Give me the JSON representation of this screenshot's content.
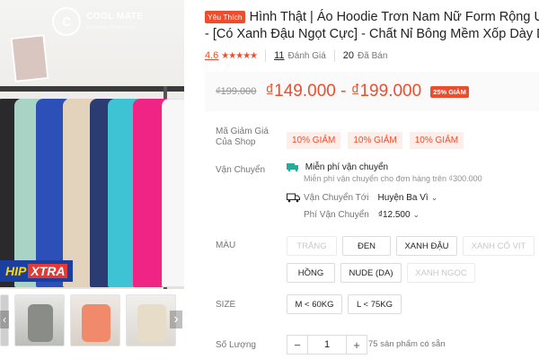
{
  "brand": {
    "logo_mark": "C",
    "name_line1": "COOL",
    "name_line2": "MATE",
    "tagline": "Everyday Outerwear"
  },
  "promo_badge": {
    "text_a": "HIP",
    "text_b": "XTRA"
  },
  "product": {
    "favorite_badge": "Yêu Thích",
    "title_line1": "Hình Thật | Áo Hoodie Trơn Nam Nữ Form Rộng Un",
    "title_line2": "- [Có Xanh Đậu Ngọt Cực] - Chất Nỉ Bông Mềm Xốp Dày Dạ",
    "rating": "4.6",
    "stars": "★★★★★",
    "review_count": "11",
    "review_label": "Đánh Giá",
    "sold_count": "20",
    "sold_label": "Đã Bán"
  },
  "price": {
    "original": "₫199.000",
    "current": "₫149.000 - ₫199.000",
    "discount": "25% GIẢM"
  },
  "vouchers": {
    "label_line1": "Mã Giảm Giá",
    "label_line2": "Của Shop",
    "items": [
      "10% GIẢM",
      "10% GIẢM",
      "10% GIẢM"
    ]
  },
  "shipping": {
    "label": "Vận Chuyển",
    "free_title": "Miễn phí vận chuyển",
    "free_sub": "Miễn phí vận chuyển cho đơn hàng trên ₫300.000",
    "to_label": "Vận Chuyển Tới",
    "to_value": "Huyện Ba Vì",
    "fee_label": "Phí Vận Chuyển",
    "fee_value": "₫12.500"
  },
  "color": {
    "label": "MÀU",
    "options": [
      "TRẮNG",
      "ĐEN",
      "XANH ĐẬU",
      "XANH CỔ VỊT",
      "HỒNG",
      "NUDE (DA)",
      "XANH NGỌC"
    ]
  },
  "size": {
    "label": "SIZE",
    "options": [
      "M < 60KG",
      "L < 75KG"
    ]
  },
  "quantity": {
    "label": "Số Lượng",
    "minus": "−",
    "value": "1",
    "plus": "+",
    "stock": "75 sản phẩm có sẵn"
  },
  "colors": {
    "accent": "#ee4d2d",
    "voucher_bg": "#fdeeea"
  },
  "icons": [
    "chevron-right-icon",
    "chevron-left-icon",
    "chevron-down-icon",
    "free-ship-icon",
    "truck-icon"
  ]
}
